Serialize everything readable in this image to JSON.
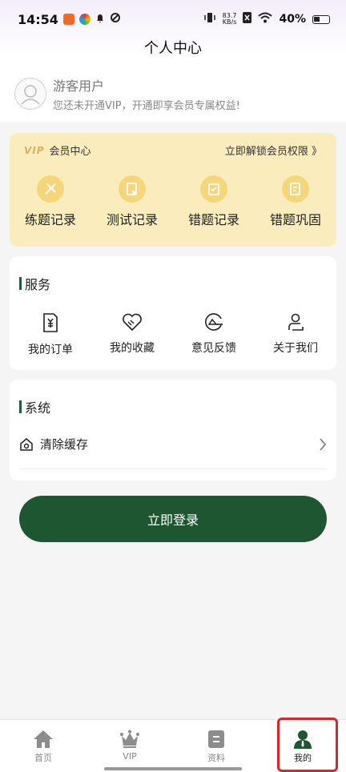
{
  "status_bar": {
    "time": "14:54",
    "net_speed_value": "83.7",
    "net_speed_unit": "KB/s",
    "battery": "40%"
  },
  "page_title": "个人中心",
  "user": {
    "name": "游客用户",
    "subtitle": "您还未开通VIP，开通即享会员专属权益!"
  },
  "vip": {
    "badge": "VIP",
    "title": "会员中心",
    "unlock_link": "立即解锁会员权限 》",
    "items": [
      {
        "label": "练题记录",
        "icon": "practice-icon"
      },
      {
        "label": "测试记录",
        "icon": "test-icon"
      },
      {
        "label": "错题记录",
        "icon": "wrong-record-icon"
      },
      {
        "label": "错题巩固",
        "icon": "consolidate-icon"
      }
    ]
  },
  "services": {
    "title": "服务",
    "items": [
      {
        "label": "我的订单",
        "icon": "order-icon"
      },
      {
        "label": "我的收藏",
        "icon": "favorite-icon"
      },
      {
        "label": "意见反馈",
        "icon": "feedback-icon"
      },
      {
        "label": "关于我们",
        "icon": "about-icon"
      }
    ]
  },
  "system": {
    "title": "系统",
    "clear_cache": "清除缓存"
  },
  "login_button": "立即登录",
  "tabbar": [
    {
      "label": "首页",
      "icon": "home-icon"
    },
    {
      "label": "VIP",
      "icon": "crown-icon"
    },
    {
      "label": "资料",
      "icon": "document-icon"
    },
    {
      "label": "我的",
      "icon": "person-icon"
    }
  ],
  "colors": {
    "primary_green": "#1e5632",
    "vip_card_bg": "#fbecbe",
    "highlight_red": "#d8262a"
  }
}
